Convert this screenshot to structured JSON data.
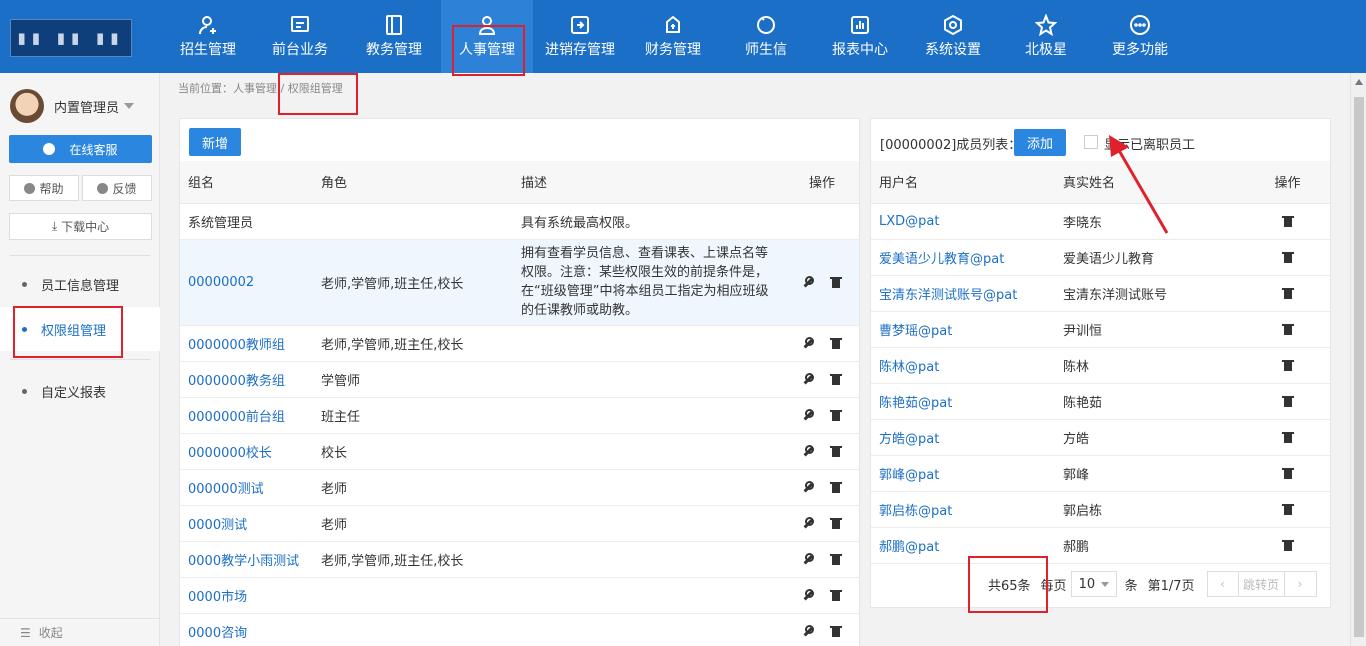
{
  "nav": {
    "items": [
      {
        "label": "招生管理",
        "icon": "user-add-icon"
      },
      {
        "label": "前台业务",
        "icon": "monitor-icon"
      },
      {
        "label": "教务管理",
        "icon": "book-icon"
      },
      {
        "label": "人事管理",
        "icon": "person-icon",
        "active": true
      },
      {
        "label": "进销存管理",
        "icon": "inventory-icon"
      },
      {
        "label": "财务管理",
        "icon": "money-bag-icon"
      },
      {
        "label": "师生信",
        "icon": "chat-icon"
      },
      {
        "label": "报表中心",
        "icon": "chart-icon"
      },
      {
        "label": "系统设置",
        "icon": "settings-icon"
      },
      {
        "label": "北极星",
        "icon": "star-icon"
      },
      {
        "label": "更多功能",
        "icon": "more-icon"
      }
    ]
  },
  "sidebar": {
    "user_name": "内置管理员",
    "service_label": "在线客服",
    "help_label": "帮助",
    "feedback_label": "反馈",
    "download_label": "下载中心",
    "menu": [
      {
        "label": "员工信息管理"
      },
      {
        "label": "权限组管理",
        "active": true
      },
      {
        "label": "自定义报表"
      }
    ],
    "collapse_label": "收起"
  },
  "breadcrumb": "当前位置：人事管理 / 权限组管理",
  "groups": {
    "add_label": "新增",
    "headers": [
      "组名",
      "角色",
      "描述",
      "操作"
    ],
    "rows": [
      {
        "name": "系统管理员",
        "role": "",
        "desc": "具有系统最高权限。",
        "link": false,
        "ops": false
      },
      {
        "name": "00000002",
        "role": "老师,学管师,班主任,校长",
        "desc": "拥有查看学员信息、查看课表、上课点名等权限。注意：某些权限生效的前提条件是，在“班级管理”中将本组员工指定为相应班级的任课教师或助教。",
        "link": true,
        "ops": true,
        "highlight": true
      },
      {
        "name": "0000000教师组",
        "role": "老师,学管师,班主任,校长",
        "desc": "",
        "link": true,
        "ops": true
      },
      {
        "name": "0000000教务组",
        "role": "学管师",
        "desc": "",
        "link": true,
        "ops": true
      },
      {
        "name": "0000000前台组",
        "role": "班主任",
        "desc": "",
        "link": true,
        "ops": true
      },
      {
        "name": "0000000校长",
        "role": "校长",
        "desc": "",
        "link": true,
        "ops": true
      },
      {
        "name": "000000测试",
        "role": "老师",
        "desc": "",
        "link": true,
        "ops": true
      },
      {
        "name": "0000测试",
        "role": "老师",
        "desc": "",
        "link": true,
        "ops": true
      },
      {
        "name": "0000教学小雨测试",
        "role": "老师,学管师,班主任,校长",
        "desc": "",
        "link": true,
        "ops": true
      },
      {
        "name": "0000市场",
        "role": "",
        "desc": "",
        "link": true,
        "ops": true
      },
      {
        "name": "0000咨询",
        "role": "",
        "desc": "",
        "link": true,
        "ops": true
      }
    ]
  },
  "members": {
    "title": "[00000002]成员列表：",
    "add_label": "添加",
    "show_left_label": "显示已离职员工",
    "headers": [
      "用户名",
      "真实姓名",
      "操作"
    ],
    "rows": [
      {
        "user": "LXD@pat",
        "real": "李晓东"
      },
      {
        "user": "爱美语少儿教育@pat",
        "real": "爱美语少儿教育"
      },
      {
        "user": "宝清东洋测试账号@pat",
        "real": "宝清东洋测试账号"
      },
      {
        "user": "曹梦瑶@pat",
        "real": "尹训恒"
      },
      {
        "user": "陈林@pat",
        "real": "陈林"
      },
      {
        "user": "陈艳茹@pat",
        "real": "陈艳茹"
      },
      {
        "user": "方皓@pat",
        "real": "方皓"
      },
      {
        "user": "郭峰@pat",
        "real": "郭峰"
      },
      {
        "user": "郭启栋@pat",
        "real": "郭启栋"
      },
      {
        "user": "郝鹏@pat",
        "real": "郝鹏"
      }
    ],
    "pager": {
      "total": "共65条",
      "per_page_label": "每页",
      "per_page_value": "10",
      "unit": "条",
      "page_info": "第1/7页",
      "jump_label": "跳转页"
    }
  },
  "colors": {
    "primary": "#1c6fc6",
    "button": "#2b86e0",
    "annotation": "#e0202a"
  }
}
